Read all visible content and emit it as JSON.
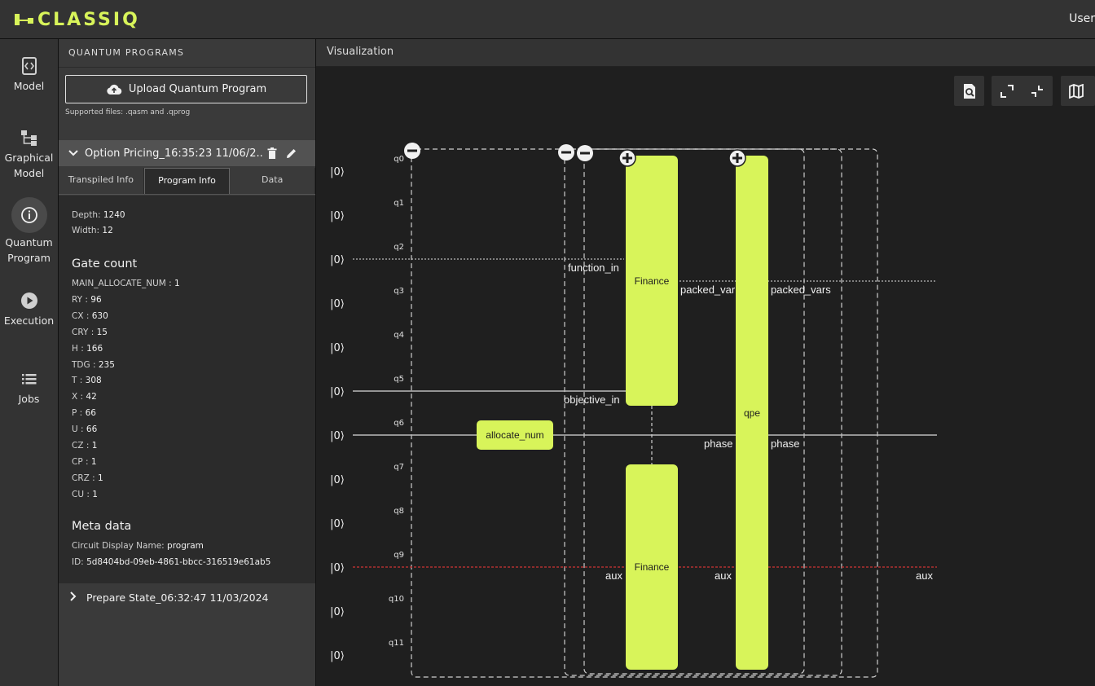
{
  "header": {
    "logo_text": "CLASSIQ",
    "user_label": "User"
  },
  "nav": {
    "items": [
      {
        "id": "model",
        "label": "Model",
        "icon": "model-icon"
      },
      {
        "id": "graphical",
        "label": "Graphical Model",
        "icon": "graphical-model-icon"
      },
      {
        "id": "quantum",
        "label": "Quantum Program",
        "icon": "info-icon",
        "active": true
      },
      {
        "id": "execution",
        "label": "Execution",
        "icon": "play-icon"
      },
      {
        "id": "jobs",
        "label": "Jobs",
        "icon": "list-icon"
      }
    ]
  },
  "panel": {
    "title": "QUANTUM PROGRAMS",
    "upload_label": "Upload Quantum Program",
    "supported_files": "Supported files: .qasm and .qprog",
    "program_name": "Option Pricing_16:35:23 11/06/2...",
    "tabs": [
      "Transpiled Info",
      "Program Info",
      "Data"
    ],
    "active_tab": "Program Info",
    "depth_label": "Depth:",
    "depth_value": "1240",
    "width_label": "Width:",
    "width_value": "12",
    "gate_count_title": "Gate count",
    "gates": [
      {
        "name": "MAIN_ALLOCATE_NUM",
        "count": "1"
      },
      {
        "name": "RY",
        "count": "96"
      },
      {
        "name": "CX",
        "count": "630"
      },
      {
        "name": "CRY",
        "count": "15"
      },
      {
        "name": "H",
        "count": "166"
      },
      {
        "name": "TDG",
        "count": "235"
      },
      {
        "name": "T",
        "count": "308"
      },
      {
        "name": "X",
        "count": "42"
      },
      {
        "name": "P",
        "count": "66"
      },
      {
        "name": "U",
        "count": "66"
      },
      {
        "name": "CZ",
        "count": "1"
      },
      {
        "name": "CP",
        "count": "1"
      },
      {
        "name": "CRZ",
        "count": "1"
      },
      {
        "name": "CU",
        "count": "1"
      }
    ],
    "meta_title": "Meta data",
    "display_name_label": "Circuit Display Name:",
    "display_name_value": "program",
    "id_label": "ID:",
    "id_value": "5d8404bd-09eb-4861-bbcc-316519e61ab5",
    "other_program": "Prepare State_06:32:47 11/03/2024"
  },
  "visualization": {
    "title": "Visualization",
    "toolbar": [
      "zoom-search-icon",
      "expand-icon",
      "collapse-icon",
      "map-icon"
    ],
    "ket_label": "|0⟩",
    "qubits": [
      "q0",
      "q1",
      "q2",
      "q3",
      "q4",
      "q5",
      "q6",
      "q7",
      "q8",
      "q9",
      "q10",
      "q11"
    ],
    "blocks": {
      "allocate": "allocate_num",
      "finance_top": "Finance",
      "finance_bottom": "Finance",
      "qpe": "qpe"
    },
    "wire_labels": {
      "function_in": "function_in",
      "objective_in": "objective_in",
      "packed_vars_1": "packed_var",
      "packed_vars_2": "packed_vars",
      "phase_1": "phase",
      "phase_2": "phase",
      "aux_1": "aux",
      "aux_2": "aux",
      "aux_3": "aux"
    },
    "colors": {
      "block": "#d8f45a",
      "aux_wire": "#b03030"
    }
  }
}
